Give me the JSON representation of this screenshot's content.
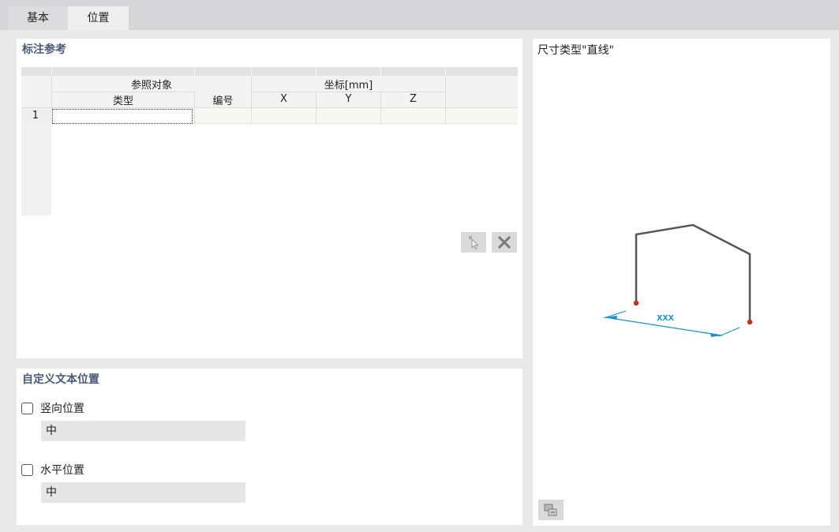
{
  "tabs": [
    {
      "label": "基本",
      "active": false
    },
    {
      "label": "位置",
      "active": true
    }
  ],
  "reference": {
    "title": "标注参考",
    "columns": {
      "ref_group": "参照对象",
      "type": "类型",
      "number": "编号",
      "coord_group": "坐标[mm]",
      "x": "X",
      "y": "Y",
      "z": "Z"
    },
    "rows": [
      {
        "index": "1",
        "type": "",
        "number": "",
        "x": "",
        "y": "",
        "z": ""
      }
    ],
    "buttons": {
      "pick_icon": "cursor-pick-icon",
      "delete_icon": "close-icon"
    }
  },
  "custom_text": {
    "title": "自定义文本位置",
    "vertical": {
      "label": "竖向位置",
      "checked": false,
      "value": "中"
    },
    "horizontal": {
      "label": "水平位置",
      "checked": false,
      "value": "中"
    }
  },
  "preview": {
    "title": "尺寸类型\"直线\"",
    "dimension_label": "xxx",
    "line_color": "#555560",
    "dimension_color": "#1a8fd0",
    "point_color": "#c0301a",
    "view_button_icon": "view-settings-icon"
  }
}
